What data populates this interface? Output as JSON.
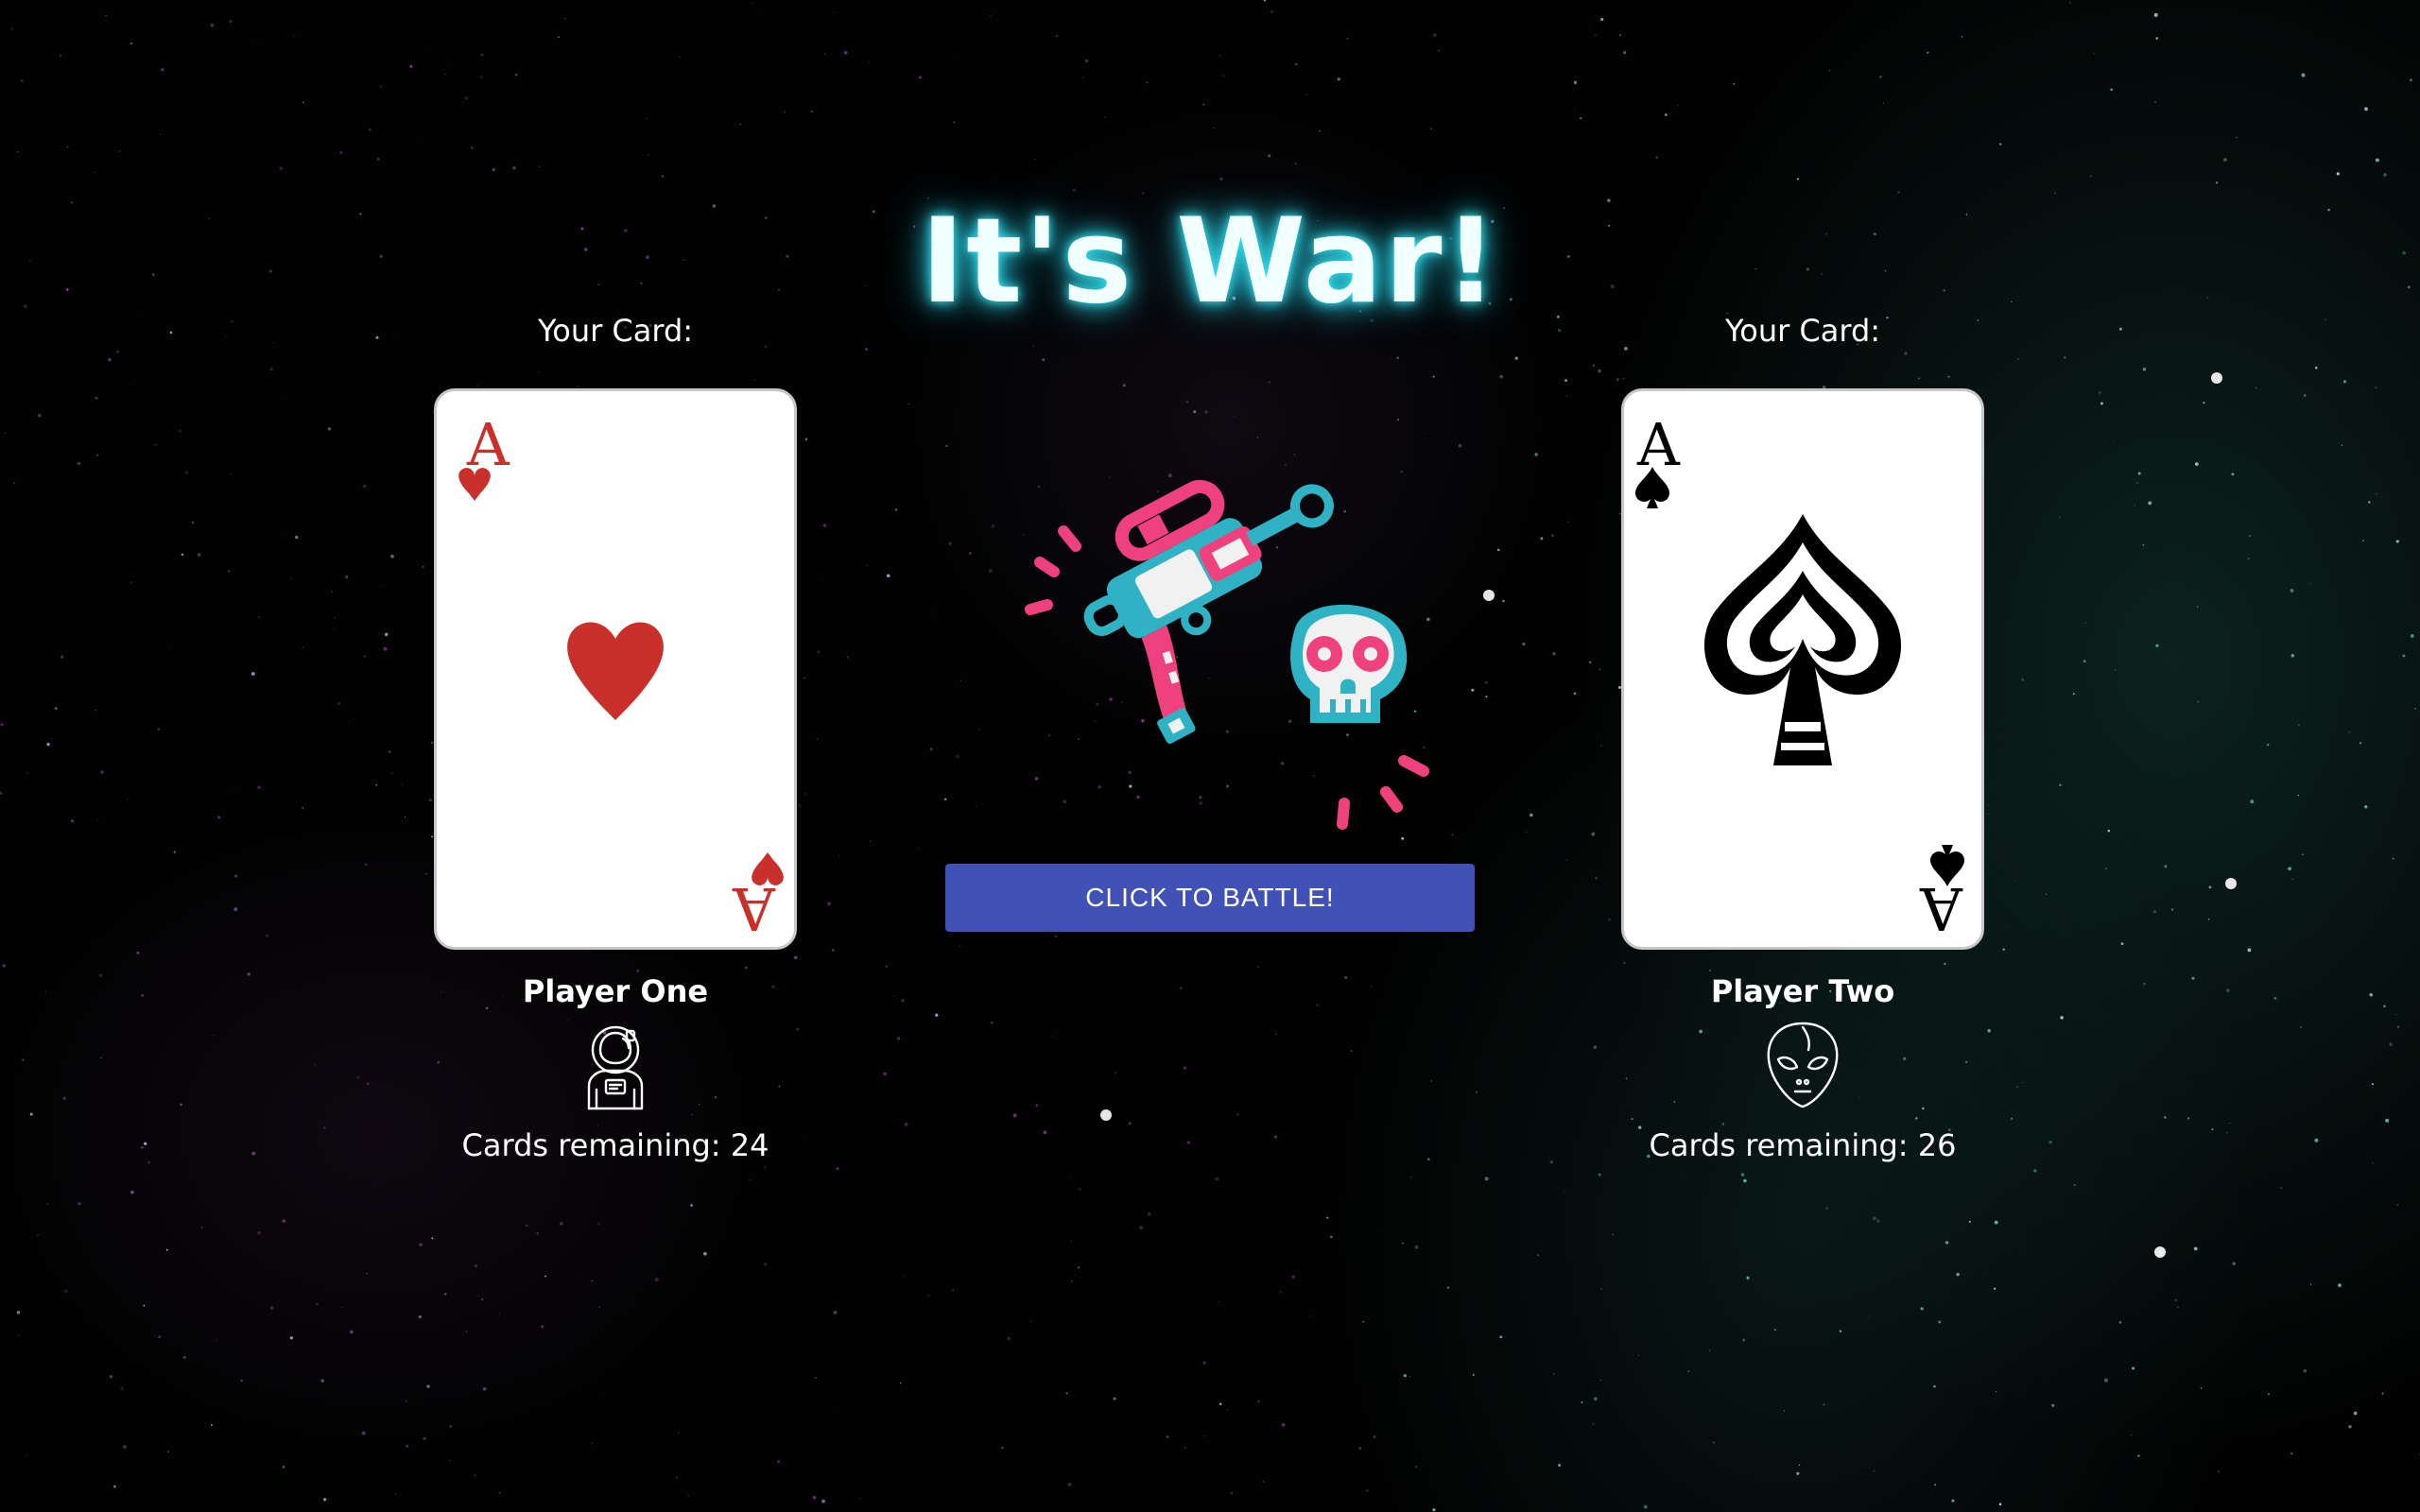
{
  "title": "It's War!",
  "player_one": {
    "card_label": "Your Card:",
    "card": {
      "rank": "A",
      "suit": "hearts",
      "suit_color": "#c9302c"
    },
    "name": "Player One",
    "avatar_icon": "astronaut-icon",
    "cards_remaining_text": "Cards remaining: 24"
  },
  "player_two": {
    "card_label": "Your Card:",
    "card": {
      "rank": "A",
      "suit": "spades",
      "suit_color": "#000000"
    },
    "name": "Player Two",
    "avatar_icon": "alien-icon",
    "cards_remaining_text": "Cards remaining: 26"
  },
  "battle": {
    "illustration_icon": "ray-gun-skull-icon",
    "button_label": "CLICK TO BATTLE!",
    "button_color": "#4251b5"
  },
  "colors": {
    "title_glow": "#37e0ec",
    "illustration_pink": "#f0417f",
    "illustration_teal": "#2fb3c4"
  }
}
